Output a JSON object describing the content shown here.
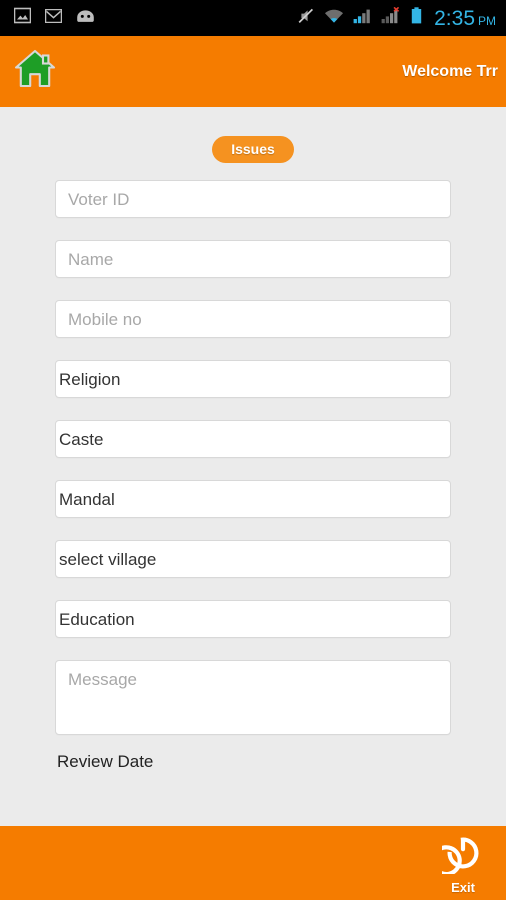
{
  "status_bar": {
    "left_icons": [
      {
        "name": "gallery-image-icon"
      },
      {
        "name": "gmail-envelope-icon"
      },
      {
        "name": "android-robot-icon"
      }
    ],
    "right_icons": [
      {
        "name": "ringer-muted-icon"
      },
      {
        "name": "wifi-icon"
      },
      {
        "name": "cellular-signal-icon"
      },
      {
        "name": "cellular-signal-no-service-icon"
      },
      {
        "name": "battery-icon"
      }
    ],
    "time": "2:35",
    "ampm": "PM",
    "time_color": "#33b5e5",
    "background": "#000000"
  },
  "header": {
    "home_icon": "home-icon",
    "home_icon_color": "#1e9e26",
    "welcome_text": "Welcome Trr",
    "background": "#f57c00"
  },
  "main": {
    "section_chip": "Issues",
    "chip_color": "#f59220",
    "background": "#ebebeb",
    "fields": [
      {
        "name": "voter-id",
        "kind": "input",
        "placeholder": "Voter ID",
        "value": ""
      },
      {
        "name": "name",
        "kind": "input",
        "placeholder": "Name",
        "value": ""
      },
      {
        "name": "mobile-no",
        "kind": "input",
        "placeholder": "Mobile no",
        "value": ""
      },
      {
        "name": "religion",
        "kind": "select",
        "placeholder": "",
        "value": "Religion"
      },
      {
        "name": "caste",
        "kind": "select",
        "placeholder": "",
        "value": "Caste"
      },
      {
        "name": "mandal",
        "kind": "select",
        "placeholder": "",
        "value": "Mandal"
      },
      {
        "name": "village",
        "kind": "select",
        "placeholder": "",
        "value": "select village"
      },
      {
        "name": "education",
        "kind": "select",
        "placeholder": "",
        "value": "Education"
      },
      {
        "name": "message",
        "kind": "textarea",
        "placeholder": "Message",
        "value": ""
      }
    ],
    "cut_off_label": "Review Date"
  },
  "bottom_bar": {
    "exit_label": "Exit",
    "exit_icon": "power-icon",
    "background": "#f57c00"
  }
}
